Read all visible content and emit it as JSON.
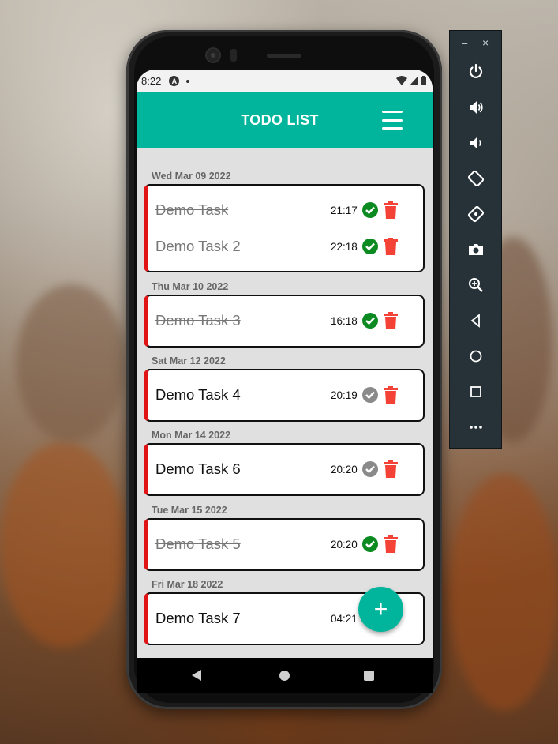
{
  "status_bar": {
    "time": "8:22",
    "indicator": "A"
  },
  "app_bar": {
    "title": "TODO LIST"
  },
  "groups": [
    {
      "date": "Wed Mar 09 2022",
      "tasks": [
        {
          "name": "Demo Task",
          "time": "21:17",
          "completed": true
        },
        {
          "name": "Demo Task 2",
          "time": "22:18",
          "completed": true
        }
      ]
    },
    {
      "date": "Thu Mar 10 2022",
      "tasks": [
        {
          "name": "Demo Task 3",
          "time": "16:18",
          "completed": true
        }
      ]
    },
    {
      "date": "Sat Mar 12 2022",
      "tasks": [
        {
          "name": "Demo Task 4",
          "time": "20:19",
          "completed": false
        }
      ]
    },
    {
      "date": "Mon Mar 14 2022",
      "tasks": [
        {
          "name": "Demo Task 6",
          "time": "20:20",
          "completed": false
        }
      ]
    },
    {
      "date": "Tue Mar 15 2022",
      "tasks": [
        {
          "name": "Demo Task 5",
          "time": "20:20",
          "completed": true
        }
      ]
    },
    {
      "date": "Fri Mar 18 2022",
      "tasks": [
        {
          "name": "Demo Task 7",
          "time": "04:21",
          "completed": false
        }
      ]
    }
  ],
  "fab": {
    "icon": "+"
  },
  "colors": {
    "accent": "#00b59b",
    "card_stripe": "#e01414",
    "done_check": "#0a8a20",
    "pending_check": "#8a8a8a",
    "trash": "#f44336"
  },
  "emulator_toolbar": {
    "minimize": "–",
    "close": "×",
    "buttons": [
      "power-icon",
      "volume-up-icon",
      "volume-down-icon",
      "rotate-left-icon",
      "rotate-right-icon",
      "camera-icon",
      "zoom-icon",
      "back-icon",
      "home-icon",
      "overview-icon",
      "more-icon"
    ]
  }
}
